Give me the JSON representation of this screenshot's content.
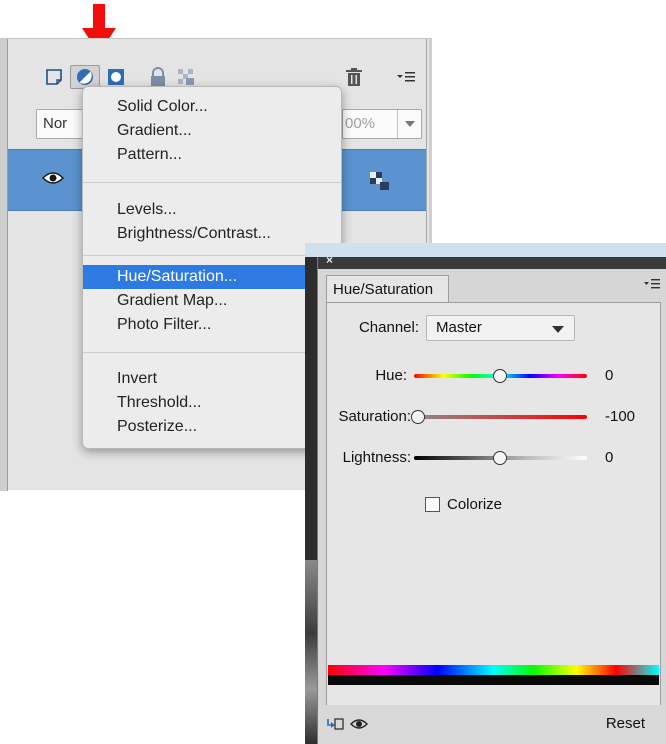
{
  "arrow": {
    "color": "#f20d0d"
  },
  "layers_panel": {
    "toolbar_icons": [
      "new-layer-icon",
      "adjustment-layer-icon",
      "layer-mask-icon",
      "lock-all-icon",
      "lock-transparency-icon",
      "trash-icon",
      "panel-menu-icon"
    ],
    "blend_mode": "Nor",
    "opacity": "00%",
    "selected_layer_color": "#5a93cf"
  },
  "menu": {
    "groups": [
      [
        "Solid Color...",
        "Gradient...",
        "Pattern..."
      ],
      [
        "Levels...",
        "Brightness/Contrast..."
      ],
      [
        "Hue/Saturation...",
        "Gradient Map...",
        "Photo Filter..."
      ],
      [
        "Invert",
        "Threshold...",
        "Posterize..."
      ]
    ],
    "selected": "Hue/Saturation...",
    "highlight_color": "#2e7ae3"
  },
  "hue_sat": {
    "close": "×",
    "tab_label": "Hue/Saturation",
    "channel_label": "Channel:",
    "channel_value": "Master",
    "hue_label": "Hue:",
    "hue_value": "0",
    "saturation_label": "Saturation:",
    "saturation_value": "-100",
    "lightness_label": "Lightness:",
    "lightness_value": "0",
    "colorize_label": "Colorize",
    "colorize_checked": false,
    "reset_label": "Reset"
  }
}
